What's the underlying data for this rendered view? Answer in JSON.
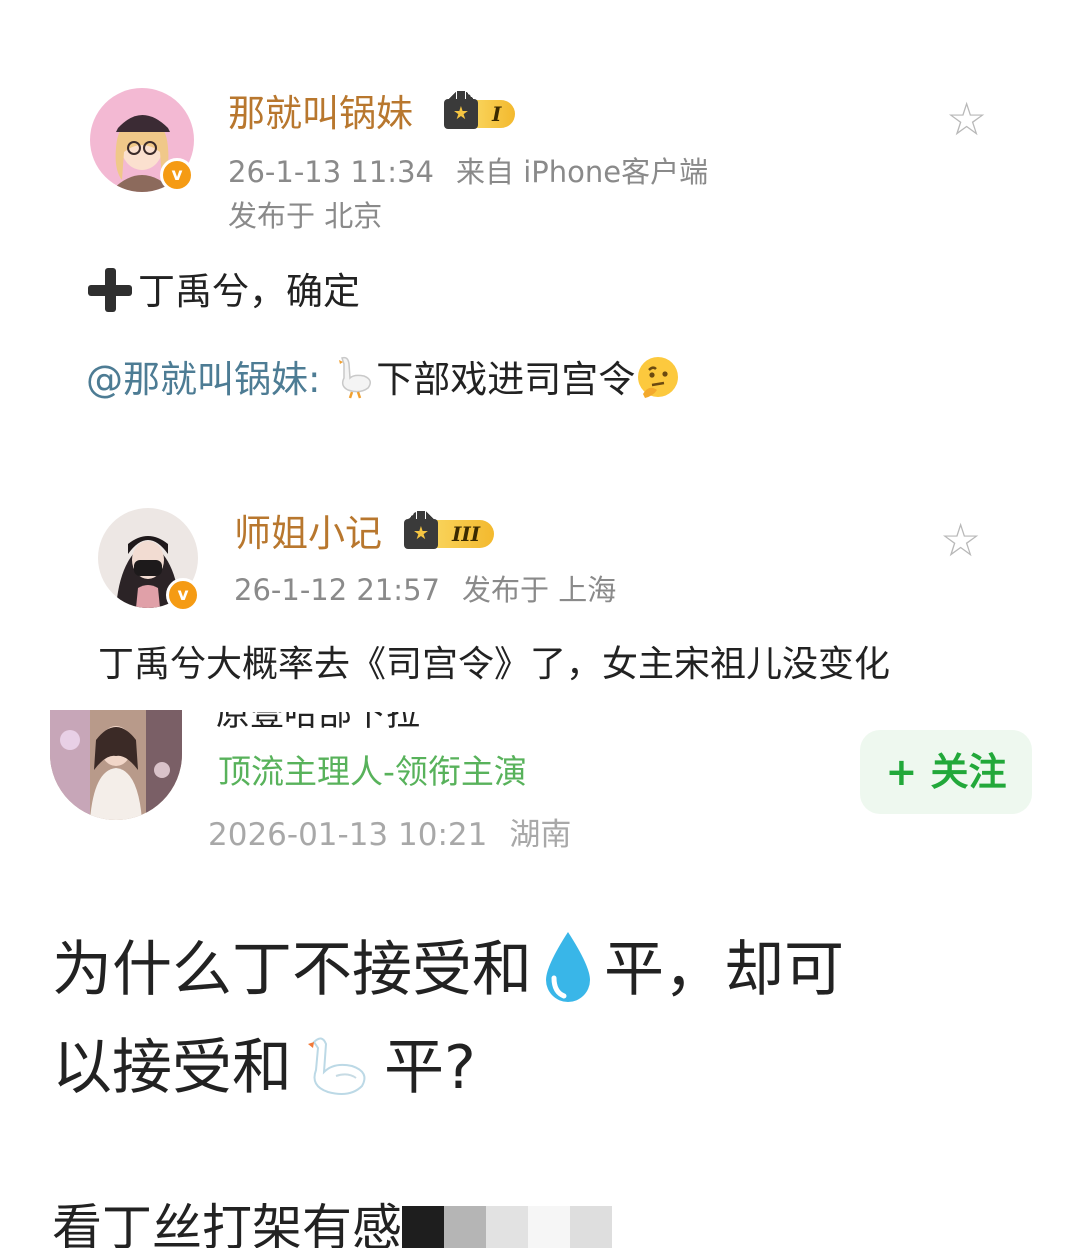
{
  "post1": {
    "username": "那就叫锅妹",
    "badge_level": "I",
    "timestamp": "26-1-13 11:34",
    "source": "来自 iPhone客户端",
    "location": "发布于 北京",
    "content": "丁禹兮，确定",
    "repost_mention": "@那就叫锅妹:",
    "repost_text": "下部戏进司宫令",
    "verified_color": "#f59b14",
    "name_color": "#b8772e"
  },
  "post2": {
    "username": "师姐小记",
    "badge_level": "III",
    "timestamp": "26-1-12 21:57",
    "location": "发布于 上海",
    "content": "丁禹兮大概率去《司宫令》了，女主宋祖儿没变化"
  },
  "post3": {
    "cut_name": "原壹哈部下拉",
    "tag": "顶流主理人-领衔主演",
    "follow_label": "+ 关注",
    "timestamp": "2026-01-13 10:21",
    "location": "湖南",
    "content_line1_a": "为什么丁不接受和",
    "content_line1_b": "平，却可",
    "content_line2_a": "以接受和",
    "content_line2_b": "平?",
    "content_line3": "看丁丝打架有感",
    "follow_color": "#22a83a",
    "tag_color": "#58b25b"
  },
  "icons": [
    "star-outline-icon",
    "plus-emoji-icon",
    "goose-emoji-icon",
    "thinking-face-emoji-icon",
    "water-drop-emoji-icon",
    "swan-emoji-icon",
    "crown-badge-icon",
    "verified-badge-icon"
  ]
}
